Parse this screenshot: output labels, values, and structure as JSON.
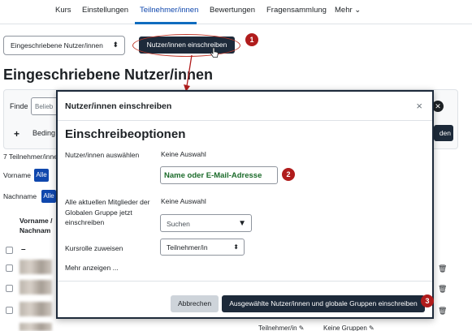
{
  "nav": {
    "tabs": [
      {
        "label": "Kurs"
      },
      {
        "label": "Einstellungen"
      },
      {
        "label": "Teilnehmer/innen"
      },
      {
        "label": "Bewertungen"
      },
      {
        "label": "Fragensammlung"
      },
      {
        "label": "Mehr ⌄"
      }
    ],
    "active_tab": "Teilnehmer/innen"
  },
  "toolbar": {
    "enrolled_select": "Eingeschriebene Nutzer/innen",
    "enrol_button": "Nutzer/innen einschreiben"
  },
  "annotations": {
    "marker_1": "1",
    "marker_2": "2",
    "marker_3": "3",
    "accent_color": "#b01c1c"
  },
  "page": {
    "title": "Eingeschriebene Nutzer/innen",
    "filter_label": "Finde",
    "filter_placeholder": "Belieb",
    "plus": "+",
    "condition_label": "Beding",
    "apply_button_fragment": "den",
    "count_text": "7 Teilnehmer/inne",
    "firstname_label": "Vorname",
    "lastname_label": "Nachname",
    "alle": "Alle",
    "column_header": "Vorname / Nachnam",
    "column_dash": "–",
    "bottom_role": "Teilnehmer/in ✎",
    "bottom_groups": "Keine Gruppen ✎"
  },
  "modal": {
    "title": "Nutzer/innen einschreiben",
    "close": "×",
    "section_heading": "Einschreibeoptionen",
    "select_users_label": "Nutzer/innen auswählen",
    "select_users_value": "Keine Auswahl",
    "name_email_placeholder": "Name oder E-Mail-Adresse",
    "cohort_label": "Alle aktuellen Mitglieder der Globalen Gruppe jetzt einschreiben",
    "cohort_value": "Keine Auswahl",
    "search_placeholder": "Suchen",
    "role_label": "Kursrolle zuweisen",
    "role_value": "Teilnehmer/in",
    "show_more": "Mehr anzeigen ...",
    "cancel_button": "Abbrechen",
    "confirm_button": "Ausgewählte Nutzer/innen und globale Gruppen einschreiben"
  }
}
